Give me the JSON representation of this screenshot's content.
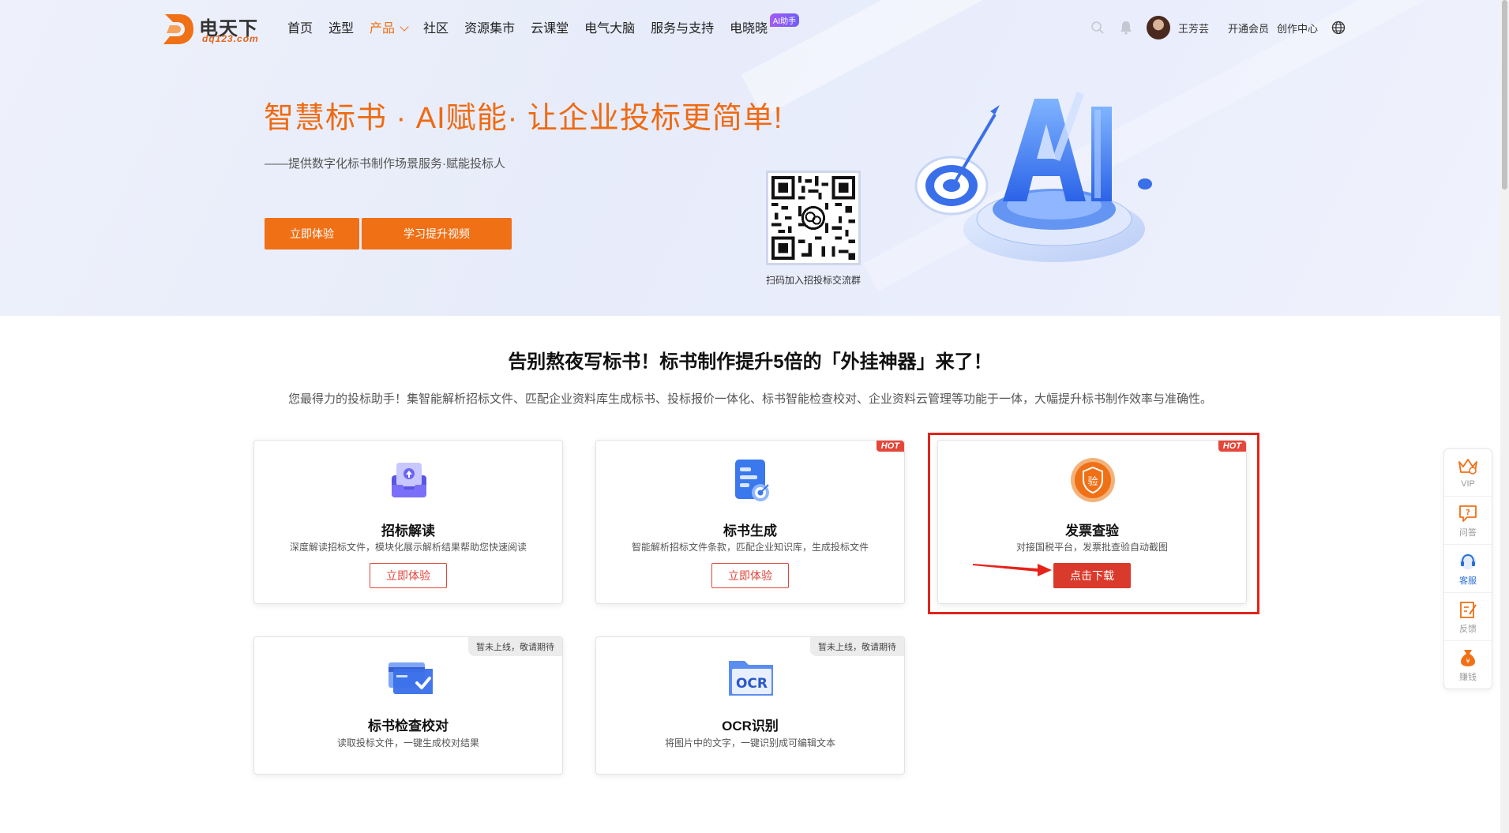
{
  "header": {
    "logo_text": "电天下",
    "logo_sub": "dq123.com",
    "nav": [
      {
        "label": "首页"
      },
      {
        "label": "选型"
      },
      {
        "label": "产品"
      },
      {
        "label": "社区"
      },
      {
        "label": "资源集市"
      },
      {
        "label": "云课堂"
      },
      {
        "label": "电气大脑"
      },
      {
        "label": "服务与支持"
      },
      {
        "label": "电晓晓"
      }
    ],
    "ai_badge": "AI助手",
    "user_name": "王芳芸",
    "open_member": "开通会员",
    "creator_center": "创作中心"
  },
  "hero": {
    "title": "智慧标书 · AI赋能· 让企业投标更简单!",
    "subtitle": "——提供数字化标书制作场景服务·赋能投标人",
    "btn_try": "立即体验",
    "btn_video": "学习提升视频",
    "qr_caption": "扫码加入招投标交流群"
  },
  "section": {
    "title": "告别熬夜写标书！标书制作提升5倍的「外挂神器」来了！",
    "desc": "您最得力的投标助手！集智能解析招标文件、匹配企业资料库生成标书、投标报价一体化、标书智能检查校对、企业资料云管理等功能于一体，大幅提升标书制作效率与准确性。"
  },
  "cards": [
    {
      "title": "招标解读",
      "desc": "深度解读招标文件，模块化展示解析结果帮助您快速阅读",
      "button": "立即体验"
    },
    {
      "title": "标书生成",
      "desc": "智能解析招标文件条款，匹配企业知识库，生成投标文件",
      "button": "立即体验",
      "badge": "HOT"
    },
    {
      "title": "发票查验",
      "desc": "对接国税平台，发票批查验自动截图",
      "button": "点击下载",
      "badge": "HOT",
      "icon_text": "验"
    },
    {
      "title": "标书检查校对",
      "desc": "读取投标文件，一键生成校对结果",
      "badge": "暂未上线，敬请期待"
    },
    {
      "title": "OCR识别",
      "desc": "将图片中的文字，一键识别成可编辑文本",
      "badge": "暂未上线，敬请期待",
      "icon_text": "OCR"
    }
  ],
  "sidebar": [
    {
      "label": "VIP"
    },
    {
      "label": "问答"
    },
    {
      "label": "客服"
    },
    {
      "label": "反馈"
    },
    {
      "label": "赚钱"
    }
  ],
  "colors": {
    "accent": "#f07016",
    "hot": "#e4473a",
    "highlight": "#e0251b"
  }
}
